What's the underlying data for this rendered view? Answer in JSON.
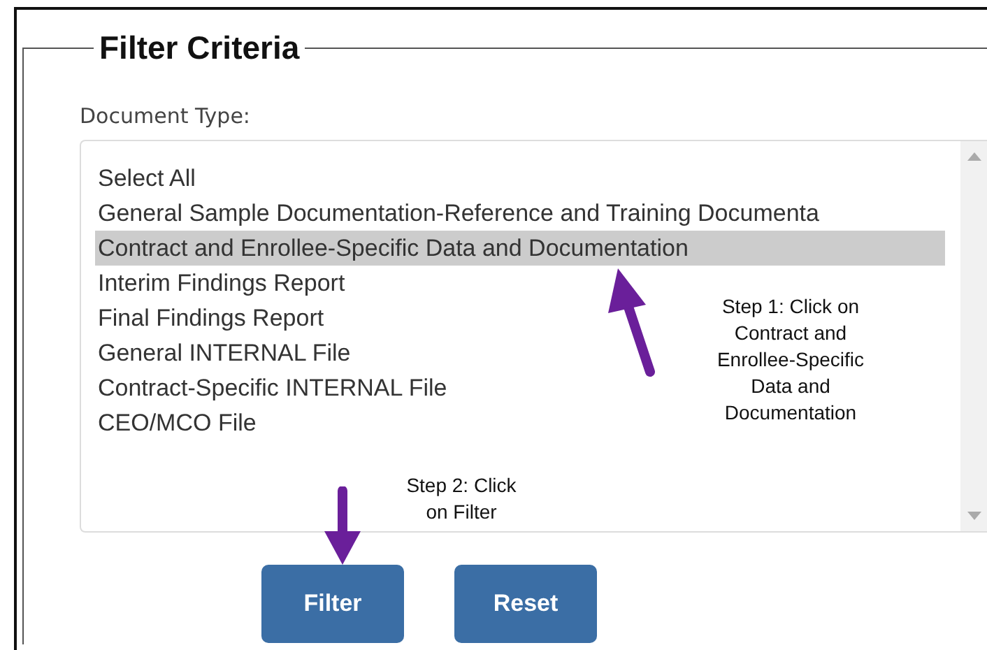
{
  "fieldset": {
    "legend": "Filter Criteria"
  },
  "document_type": {
    "label": "Document Type:",
    "options": [
      {
        "label": "Select All",
        "selected": false
      },
      {
        "label": "General Sample Documentation-Reference and Training Documenta",
        "selected": false
      },
      {
        "label": "Contract and Enrollee-Specific Data and Documentation",
        "selected": true
      },
      {
        "label": "Interim Findings Report",
        "selected": false
      },
      {
        "label": "Final Findings Report",
        "selected": false
      },
      {
        "label": "General INTERNAL File",
        "selected": false
      },
      {
        "label": "Contract-Specific INTERNAL File",
        "selected": false
      },
      {
        "label": "CEO/MCO File",
        "selected": false
      }
    ]
  },
  "annotations": [
    {
      "text": "Step 1: Click on Contract and Enrollee-Specific Data and Documentation"
    },
    {
      "text": "Step 2: Click on Filter"
    }
  ],
  "buttons": [
    "Filter",
    "Reset"
  ]
}
